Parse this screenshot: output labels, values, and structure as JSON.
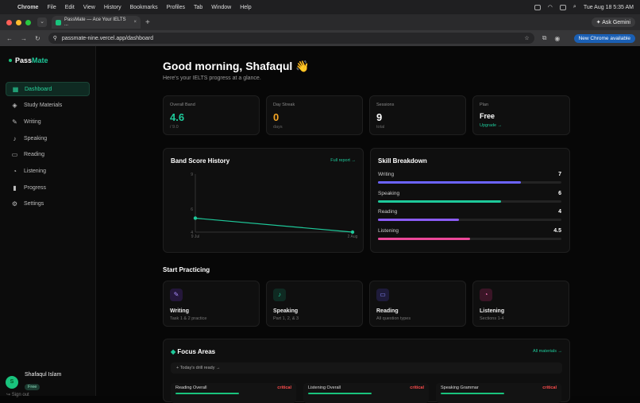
{
  "system": {
    "menu": [
      "Chrome",
      "File",
      "Edit",
      "View",
      "History",
      "Bookmarks",
      "Profiles",
      "Tab",
      "Window",
      "Help"
    ],
    "clock": "Tue Aug 18  5:35 AM"
  },
  "browser": {
    "tab_title": "PassMate — Ace Your IELTS ...",
    "ask_gemini": "Ask Gemini",
    "url": "passmate-nine.vercel.app/dashboard",
    "new_chrome": "New Chrome available"
  },
  "sidebar": {
    "logo_a": "Pass",
    "logo_b": "Mate",
    "items": [
      {
        "label": "Dashboard",
        "icon": "▦"
      },
      {
        "label": "Study Materials",
        "icon": "◈"
      },
      {
        "label": "Writing",
        "icon": "✎"
      },
      {
        "label": "Speaking",
        "icon": "♪"
      },
      {
        "label": "Reading",
        "icon": "▭"
      },
      {
        "label": "Listening",
        "icon": "◔"
      },
      {
        "label": "Progress",
        "icon": "▮"
      },
      {
        "label": "Settings",
        "icon": "⚙"
      }
    ],
    "user": {
      "initial": "S",
      "name": "Shafaqul Islam",
      "plan": "Free"
    },
    "signout": "Sign out"
  },
  "header": {
    "greeting": "Good morning, Shafaqul 👋",
    "subtitle": "Here's your IELTS progress at a glance."
  },
  "stats": [
    {
      "label": "Overall Band",
      "value": "4.6",
      "note": "/ 9.0",
      "color": "#1ec99a"
    },
    {
      "label": "Day Streak",
      "value": "0",
      "note": "days",
      "color": "#f5a524"
    },
    {
      "label": "Sessions",
      "value": "9",
      "note": "total",
      "color": "#ffffff"
    },
    {
      "label": "Plan",
      "value": "Free",
      "link": "Upgrade →"
    }
  ],
  "band_history": {
    "title": "Band Score History",
    "link": "Full report →"
  },
  "chart_data": {
    "type": "line",
    "x": [
      "9 Jul",
      "2 Aug"
    ],
    "series": [
      {
        "values": [
          5.2,
          4.0
        ]
      }
    ],
    "ylim": [
      4,
      9
    ],
    "yticks": [
      "9",
      "6",
      "4"
    ],
    "color": "#1ec99a"
  },
  "skills": {
    "title": "Skill Breakdown",
    "items": [
      {
        "name": "Writing",
        "score": "7",
        "fraction": 0.78,
        "color": "#6c63ff"
      },
      {
        "name": "Speaking",
        "score": "6",
        "fraction": 0.67,
        "color": "#1ec99a"
      },
      {
        "name": "Reading",
        "score": "4",
        "fraction": 0.44,
        "color": "#8b5cf6"
      },
      {
        "name": "Listening",
        "score": "4.5",
        "fraction": 0.5,
        "color": "#ec4899"
      }
    ]
  },
  "practice": {
    "title": "Start Practicing",
    "items": [
      {
        "name": "Writing",
        "desc": "Task 1 & 2 practice",
        "icon": "✎",
        "bg": "#24173a",
        "fg": "#a78bfa"
      },
      {
        "name": "Speaking",
        "desc": "Part 1, 2, & 3",
        "icon": "♪",
        "bg": "#0f2a22",
        "fg": "#1ec99a"
      },
      {
        "name": "Reading",
        "desc": "All question types",
        "icon": "▭",
        "bg": "#1e1b3a",
        "fg": "#8b8bff"
      },
      {
        "name": "Listening",
        "desc": "Sections 1-4",
        "icon": "◔",
        "bg": "#3a1526",
        "fg": "#f472b6"
      }
    ]
  },
  "focus": {
    "title": "Focus Areas",
    "link": "All materials →",
    "drill": "Today's drill ready →",
    "items": [
      {
        "name": "Reading Overall",
        "tag": "critical"
      },
      {
        "name": "Listening Overall",
        "tag": "critical"
      },
      {
        "name": "Speaking Grammar",
        "tag": "critical"
      }
    ]
  }
}
